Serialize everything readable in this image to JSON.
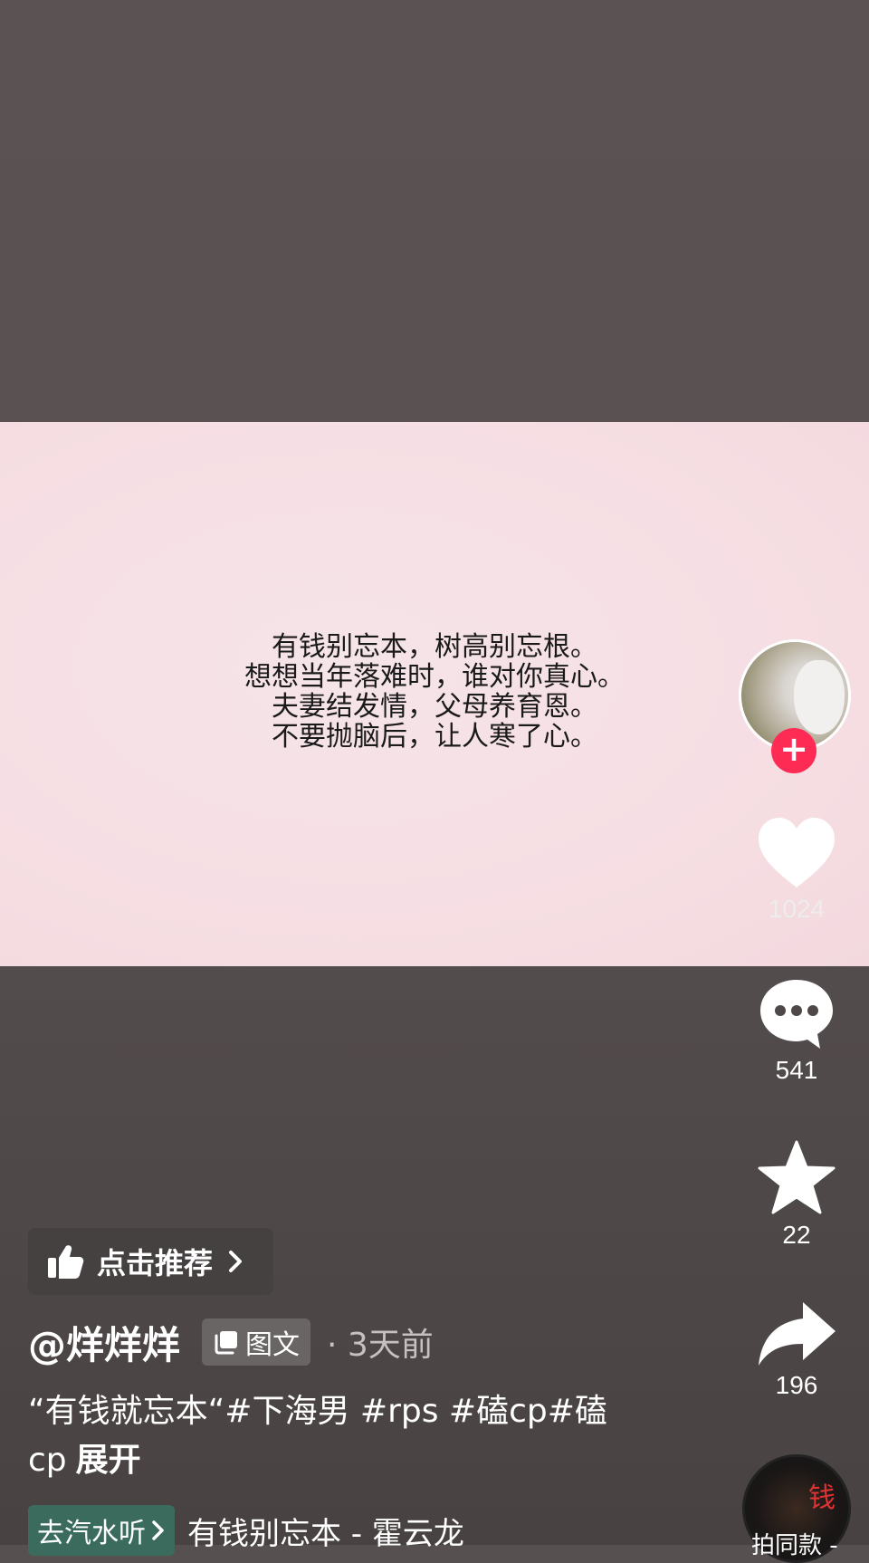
{
  "poem": {
    "lines": [
      "有钱别忘本，树高别忘根。",
      "想想当年落难时，谁对你真心。",
      "夫妻结发情，父母养育恩。",
      "不要抛脑后，让人寒了心。"
    ]
  },
  "actions": {
    "follow_symbol": "+",
    "likes": "1024",
    "comments": "541",
    "favorites": "22",
    "shares": "196"
  },
  "post": {
    "recommend_label": "点击推荐",
    "author": "@烊烊烊",
    "type_badge": "图文",
    "time": "· 3天前",
    "description": "“有钱就忘本“#下海男 #rps #磕cp#磕cp",
    "expand_label": "展开"
  },
  "music": {
    "go_listen_label": "去汽水听",
    "song": "有钱别忘本 - 霍云龙",
    "disc_glyph": "钱",
    "bottom_label": "拍同款 -"
  },
  "colors": {
    "accent": "#fe2c55",
    "background": "#575050",
    "image_bg": "#f6dfe4",
    "go_listen_bg": "#3a6b5d"
  }
}
